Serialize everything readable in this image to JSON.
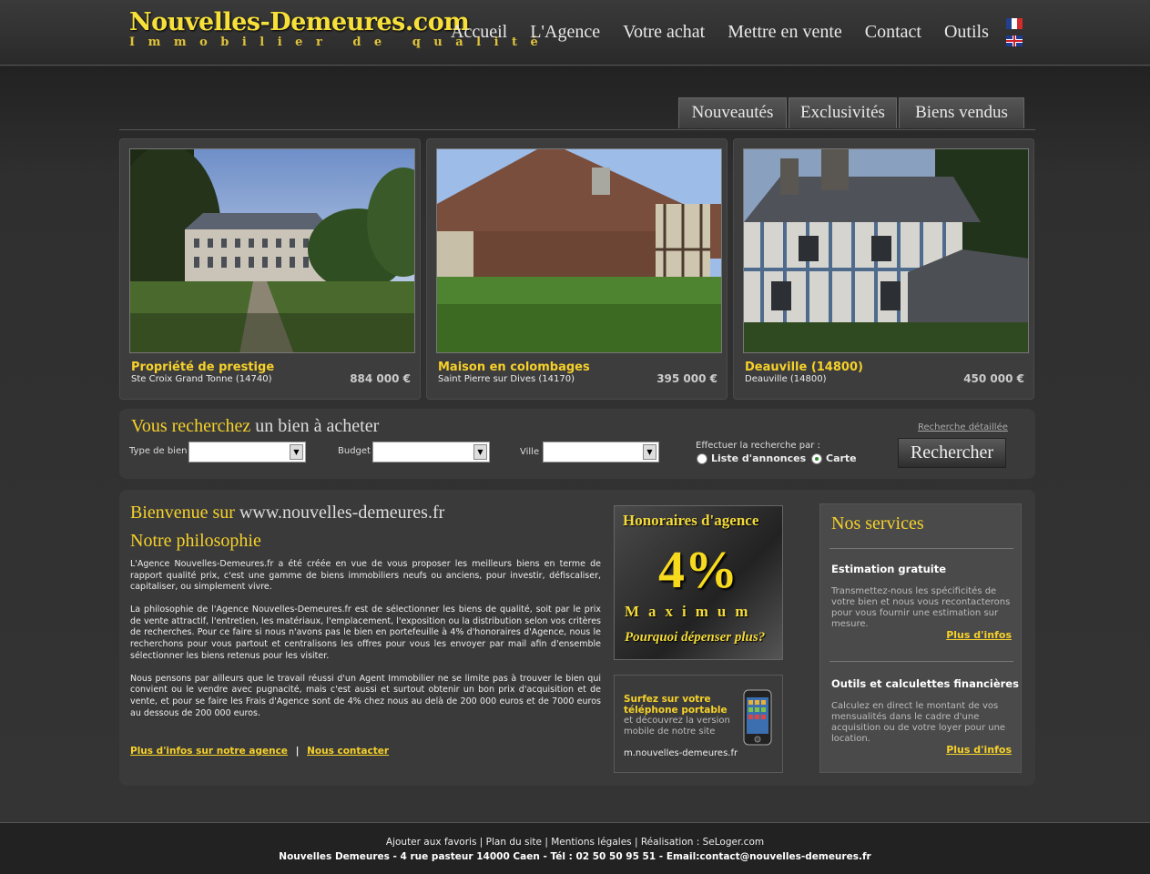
{
  "logo": {
    "title": "Nouvelles-Demeures.com",
    "subtitle": "Immobilier de qualité"
  },
  "nav": {
    "items": [
      "Accueil",
      "L'Agence",
      "Votre achat",
      "Mettre en vente",
      "Contact",
      "Outils"
    ]
  },
  "tabs": [
    "Nouveautés",
    "Exclusivités",
    "Biens vendus"
  ],
  "listings": [
    {
      "title": "Propriété de prestige",
      "location": "Ste Croix Grand Tonne (14740)",
      "price": "884 000 €"
    },
    {
      "title": "Maison en colombages",
      "location": "Saint Pierre sur Dives (14170)",
      "price": "395 000 €"
    },
    {
      "title": "Deauville (14800)",
      "location": "Deauville (14800)",
      "price": "450 000 €"
    }
  ],
  "search": {
    "title_highlight": "Vous recherchez",
    "title_rest": "un bien à acheter",
    "type_label": "Type de bien",
    "budget_label": "Budget",
    "ville_label": "Ville",
    "search_by": "Effectuer la recherche par :",
    "option_list": "Liste d'annonces",
    "option_map": "Carte",
    "advanced_link": "Recherche détaillée",
    "button": "Rechercher"
  },
  "welcome": {
    "title_highlight": "Bienvenue sur",
    "title_rest": "www.nouvelles-demeures.fr",
    "philosophy_title": "Notre philosophie",
    "paragraphs": [
      "L'Agence Nouvelles-Demeures.fr a été créée en vue de vous proposer les meilleurs biens en terme de rapport qualité prix, c'est une gamme de biens immobiliers neufs ou anciens, pour investir, défiscaliser, capitaliser, ou simplement vivre.",
      "La philosophie de l'Agence Nouvelles-Demeures.fr est de sélectionner les biens de qualité, soit par le prix de vente attractif, l'entretien, les matériaux, l'emplacement, l'exposition ou la distribution selon vos critères de recherches. Pour ce faire si nous n'avons pas le bien en portefeuille à 4% d'honoraires d'Agence, nous le recherchons pour vous partout et centralisons les offres pour vous les envoyer par mail afin d'ensemble sélectionner les biens retenus pour les visiter.",
      "Nous pensons par ailleurs que le travail réussi d'un Agent Immobilier ne se limite pas à trouver le bien qui convient ou le vendre avec pugnacité, mais c'est aussi et surtout obtenir un bon prix d'acquisition et de vente, et pour se faire les Frais d'Agence sont de 4% chez nous au delà de 200 000 euros et de 7000 euros au dessous de 200 000 euros."
    ],
    "link_more": "Plus d'infos sur notre agence",
    "separator": "|",
    "link_contact": "Nous contacter"
  },
  "promo": {
    "line1": "Honoraires d'agence",
    "line2": "4%",
    "line3": "Maximum",
    "line4": "Pourquoi dépenser plus?"
  },
  "mobile": {
    "title": "Surfez sur votre téléphone portable",
    "text": "et découvrez la version mobile de notre site",
    "url": "m.nouvelles-demeures.fr"
  },
  "services": {
    "title": "Nos services",
    "items": [
      {
        "title": "Estimation gratuite",
        "text": "Transmettez-nous les spécificités de votre bien et nous vous recontacterons pour vous fournir une estimation sur mesure.",
        "link": "Plus d'infos"
      },
      {
        "title": "Outils et calculettes financières",
        "text": "Calculez en direct le montant de vos mensualités dans le cadre d'une acquisition ou de votre loyer pour une location.",
        "link": "Plus d'infos"
      }
    ]
  },
  "footer": {
    "links": [
      "Ajouter aux favoris",
      "Plan du site",
      "Mentions légales",
      "Réalisation : SeLoger.com"
    ],
    "address": "Nouvelles Demeures - 4 rue pasteur 14000 Caen - Tél : 02 50 50 95 51 - Email:contact@nouvelles-demeures.fr"
  },
  "colors": {
    "accent": "#f6d12a",
    "background": "#2b2b2b",
    "panel": "#3a3a3a"
  }
}
